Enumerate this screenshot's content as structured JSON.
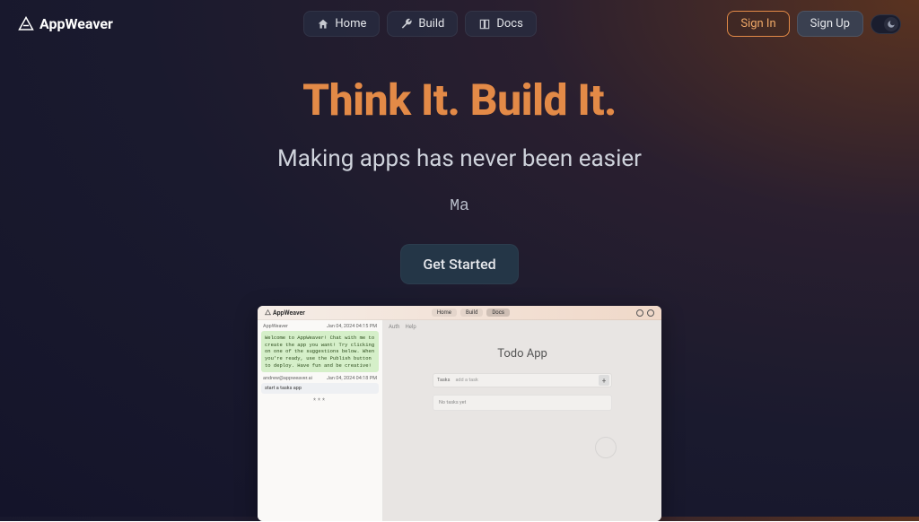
{
  "brand": "AppWeaver",
  "nav": {
    "items": [
      {
        "label": "Home"
      },
      {
        "label": "Build"
      },
      {
        "label": "Docs"
      }
    ],
    "signin": "Sign In",
    "signup": "Sign Up"
  },
  "hero": {
    "title": "Think It. Build It.",
    "subtitle": "Making apps has never been easier",
    "typing": "Ma",
    "cta": "Get Started"
  },
  "demo": {
    "brand": "AppWeaver",
    "nav": [
      "Home",
      "Build",
      "Docs"
    ],
    "chat": {
      "bot_name": "AppWeaver",
      "bot_time": "Jan 04, 2024  04:15 PM",
      "bot_msg": "Welcome to AppWeaver! Chat with me to create the app you want! Try clicking on one of the suggestions below. When you're ready, use the Publish button to deploy. Have fun and be creative!",
      "user_name": "andrew@appweaver.ai",
      "user_time": "Jan 04, 2024  04:18 PM",
      "user_msg": "start a tasks app"
    },
    "preview": {
      "tabs": [
        "Auth",
        "Help"
      ],
      "title": "Todo App",
      "input_label": "Tasks",
      "input_placeholder": "add a task",
      "empty": "No tasks yet"
    }
  }
}
